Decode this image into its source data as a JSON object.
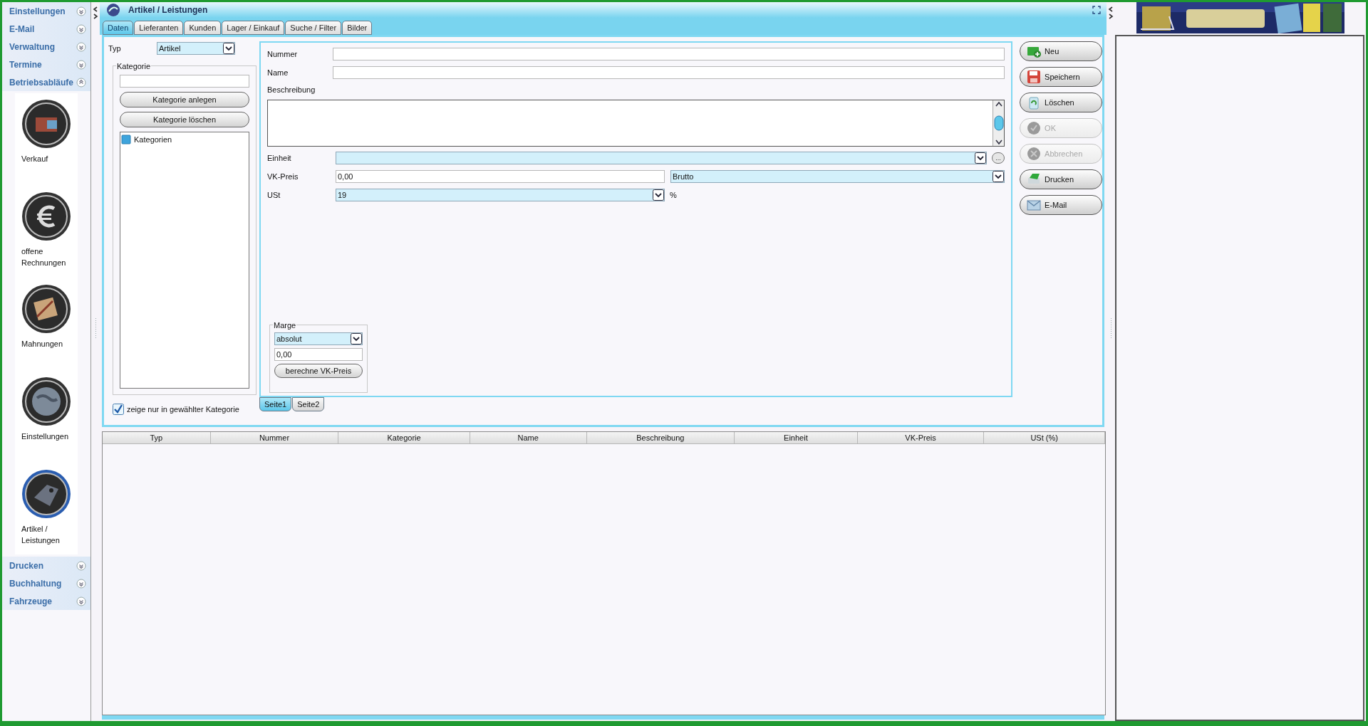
{
  "window": {
    "title": "Artikel / Leistungen"
  },
  "sidebar": {
    "sections": [
      {
        "label": "Einstellungen",
        "expanded": false
      },
      {
        "label": "E-Mail",
        "expanded": false
      },
      {
        "label": "Verwaltung",
        "expanded": false
      },
      {
        "label": "Termine",
        "expanded": false
      },
      {
        "label": "Betriebsabläufe",
        "expanded": true,
        "items": [
          {
            "label": "Verkauf",
            "selected": false
          },
          {
            "label": "offene Rechnungen",
            "selected": false
          },
          {
            "label": "Mahnungen",
            "selected": false
          },
          {
            "label": "Einstellungen",
            "selected": false
          },
          {
            "label": "Artikel / Leistungen",
            "selected": true
          }
        ]
      },
      {
        "label": "Drucken",
        "expanded": false
      },
      {
        "label": "Buchhaltung",
        "expanded": false
      },
      {
        "label": "Fahrzeuge",
        "expanded": false
      }
    ]
  },
  "tabs": [
    {
      "label": "Daten",
      "selected": true
    },
    {
      "label": "Lieferanten",
      "selected": false
    },
    {
      "label": "Kunden",
      "selected": false
    },
    {
      "label": "Lager / Einkauf",
      "selected": false
    },
    {
      "label": "Suche / Filter",
      "selected": false
    },
    {
      "label": "Bilder",
      "selected": false
    }
  ],
  "type_field": {
    "label": "Typ",
    "value": "Artikel"
  },
  "category": {
    "legend": "Kategorie",
    "buttons": [
      "Kategorie anlegen",
      "Kategorie löschen"
    ],
    "tree": [
      {
        "label": "Kategorien"
      }
    ],
    "filter": {
      "label": "zeige nur in gewählter Kategorie",
      "checked": true
    }
  },
  "form": {
    "nummer": {
      "label": "Nummer"
    },
    "name": {
      "label": "Name"
    },
    "beschreibung": {
      "label": "Beschreibung"
    },
    "einheit": {
      "label": "Einheit",
      "button": "..."
    },
    "vk_preis": {
      "label": "VK-Preis",
      "value": "0,00",
      "mode": "Brutto"
    },
    "ust": {
      "label": "USt",
      "value": "19",
      "unit": "%"
    },
    "margin": {
      "legend": "Marge",
      "mode": "absolut",
      "value": "0,00",
      "button": "berechne VK-Preis"
    }
  },
  "pages": [
    {
      "label": "Seite1",
      "selected": true
    },
    {
      "label": "Seite2",
      "selected": false
    }
  ],
  "actions": [
    {
      "label": "Neu",
      "disabled": false
    },
    {
      "label": "Speichern",
      "disabled": false
    },
    {
      "label": "Löschen",
      "disabled": false
    },
    {
      "label": "OK",
      "disabled": true
    },
    {
      "label": "Abbrechen",
      "disabled": true
    },
    {
      "label": "Drucken",
      "disabled": false
    },
    {
      "label": "E-Mail",
      "disabled": false
    }
  ],
  "table": {
    "columns": [
      "Typ",
      "Nummer",
      "Kategorie",
      "Name",
      "Beschreibung",
      "Einheit",
      "VK-Preis",
      "USt (%)"
    ]
  }
}
